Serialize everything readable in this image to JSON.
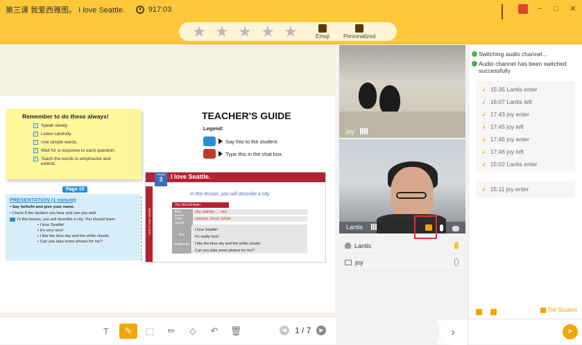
{
  "window": {
    "title": "第三课 我爱西雅图。 I love Seattle.",
    "timer": "917:03",
    "controls": [
      "signal-icon",
      "screen-share-icon",
      "minimize-icon",
      "maximize-icon",
      "close-icon"
    ]
  },
  "rating": {
    "stars_total": 5,
    "stars_filled": 0,
    "emoji_label": "Emoji",
    "personalized_label": "Personalized"
  },
  "material": {
    "sticky_title": "Remember to do these always!",
    "checklist": [
      "Speak slowly.",
      "Listen carefully.",
      "Use simple words.",
      "Wait for a response to each question.",
      "Teach the words to emphasize and extend."
    ],
    "page_badge": "Page 15",
    "presentation_heading": "PRESENTATION (1 minute)",
    "presentation_items": [
      "Say hello/hi and give your name.",
      "Check if the student can hear and see you well.",
      "In this lesson, you will describe a city. You should learn:"
    ],
    "presentation_subitems": [
      "I love Seattle!",
      "It's very nice!",
      "I like the blue sky and the white clouds.",
      "Can you take some photos for me?"
    ],
    "guide_title": "TEACHER'S GUIDE",
    "legend_label": "Legend:",
    "legend_say": "Say this to the student.",
    "legend_type": "Type this in the chat box.",
    "lesson_label": "Lesson",
    "lesson_number": "3",
    "lesson_title": "I love Seattle.",
    "unit_vertical": "Unit 6 I love Seattle.",
    "lesson_intro": "In this lesson, you will describe a city.",
    "should_learn": "You should learn",
    "key_words_label": "Key words",
    "key_words": "sky, sightse…, sea",
    "core_words_label": "Core words",
    "core_words": "camera, cloud, whale",
    "key_sentences_label": "Key sentences",
    "key_sentences": [
      "I love Seattle!",
      "It's really nice!",
      "I like the blue sky and the white clouds.",
      "Can you take some photos for me?"
    ]
  },
  "tools": {
    "items": [
      "text-tool",
      "pen-tool",
      "select-tool",
      "marker-tool",
      "eraser-tool",
      "undo-tool",
      "delete-tool"
    ],
    "active": "pen-tool",
    "page_current": "1",
    "page_total": "7",
    "page_display": "1 / 7"
  },
  "video": {
    "student_name": "joy",
    "teacher_name": "Lantis"
  },
  "participants": [
    {
      "name": "Lantis",
      "icon": "teacher-icon",
      "mic": "mic-active"
    },
    {
      "name": "joy",
      "icon": "monitor-icon",
      "mic": "mic-idle"
    }
  ],
  "chat": {
    "system_messages": [
      "Switching audio channel...",
      "Audio channel has been switched successfully"
    ],
    "events_1": [
      "15:35 Lantis enter",
      "16:07 Lantis left",
      "17:43 joy enter",
      "17:45 joy left",
      "17:45 joy enter",
      "17:46 joy left",
      "15:02 Lantis enter"
    ],
    "events_2": [
      "15:11 joy enter"
    ],
    "tell_student": "Tell Student",
    "accent": "#f4a500"
  }
}
